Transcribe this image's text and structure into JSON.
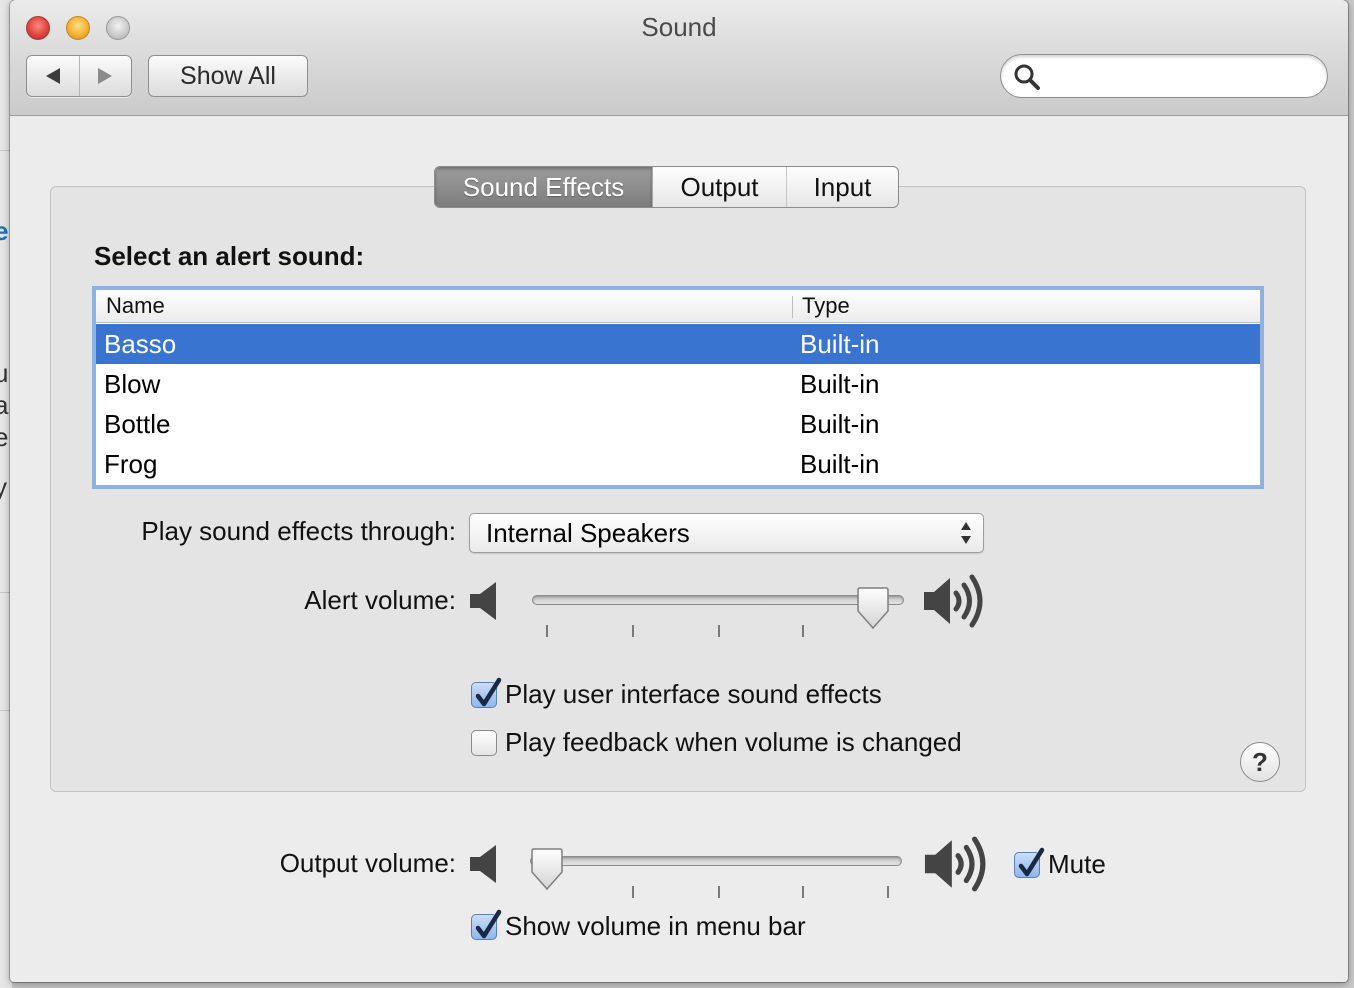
{
  "window": {
    "title": "Sound"
  },
  "toolbar": {
    "show_all_label": "Show All",
    "search_placeholder": "",
    "search_value": ""
  },
  "tabs": [
    {
      "label": "Sound Effects",
      "active": true
    },
    {
      "label": "Output",
      "active": false
    },
    {
      "label": "Input",
      "active": false
    }
  ],
  "sound_effects": {
    "heading": "Select an alert sound:",
    "columns": {
      "name": "Name",
      "type": "Type"
    },
    "rows": [
      {
        "name": "Basso",
        "type": "Built-in",
        "selected": true
      },
      {
        "name": "Blow",
        "type": "Built-in",
        "selected": false
      },
      {
        "name": "Bottle",
        "type": "Built-in",
        "selected": false
      },
      {
        "name": "Frog",
        "type": "Built-in",
        "selected": false
      }
    ],
    "play_through_label": "Play sound effects through:",
    "play_through_value": "Internal Speakers",
    "alert_volume_label": "Alert volume:",
    "alert_volume_fraction": 0.96,
    "ui_sound_effects_label": "Play user interface sound effects",
    "ui_sound_effects_checked": true,
    "feedback_label": "Play feedback when volume is changed",
    "feedback_checked": false,
    "help_label": "?"
  },
  "output": {
    "volume_label": "Output volume:",
    "volume_fraction": 0.0,
    "mute_label": "Mute",
    "mute_checked": true,
    "show_in_menu_bar_label": "Show volume in menu bar",
    "show_in_menu_bar_checked": true
  },
  "colors": {
    "selection": "#3a74d1",
    "close": "#e0443e",
    "minimize": "#f5b133",
    "zoom": "#c8c8c8"
  },
  "icons": {
    "back": "triangle-left",
    "forward": "triangle-right",
    "search": "magnifier",
    "speaker_low": "speaker",
    "speaker_high": "speaker-with-waves",
    "popup_arrows": "up-down-arrows"
  }
}
